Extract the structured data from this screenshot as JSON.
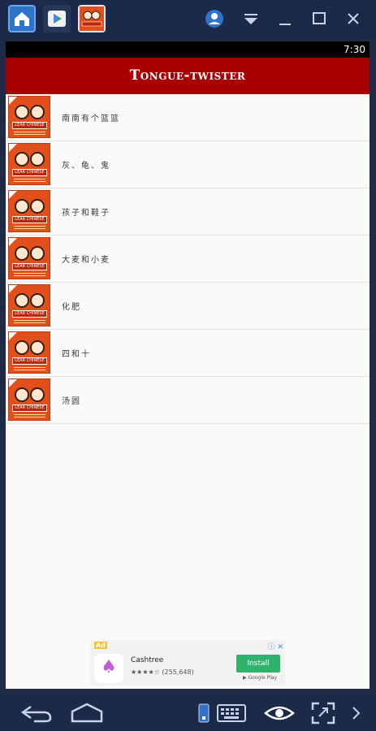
{
  "emulator": {
    "tabs": [
      {
        "name": "home",
        "icon": "home-icon"
      },
      {
        "name": "play-store",
        "icon": "play-store-icon"
      },
      {
        "name": "app",
        "icon": "app-thumbnail-icon"
      }
    ],
    "top_icons": [
      "account-icon",
      "dropdown-icon",
      "minimize-icon",
      "maximize-icon",
      "close-icon"
    ],
    "bottom_icons": [
      "back-icon",
      "home-icon",
      "phone-icon",
      "keyboard-icon",
      "eye-icon",
      "fullscreen-icon",
      "chevron-right-icon"
    ]
  },
  "status_bar": {
    "time": "7:30"
  },
  "app_bar": {
    "title": "Tongue-twister",
    "color": "#a80000"
  },
  "list": {
    "items": [
      {
        "label": "南南有个篮篮",
        "thumb_text": "LEAR CHINESE"
      },
      {
        "label": "灰、龟、鬼",
        "thumb_text": "LEAR CHINESE"
      },
      {
        "label": "孩子和鞋子",
        "thumb_text": "LEAR CHINESE"
      },
      {
        "label": "大麦和小麦",
        "thumb_text": "LEAR CHINESE"
      },
      {
        "label": "化肥",
        "thumb_text": "LEAR CHINESE"
      },
      {
        "label": "四和十",
        "thumb_text": "LEAR CHINESE"
      },
      {
        "label": "汤圆",
        "thumb_text": "LEAR CHINESE"
      }
    ]
  },
  "ad": {
    "tag": "Ad",
    "name": "Cashtree",
    "rating": "★★★★☆ (255,648)",
    "install_label": "Install",
    "store_label": "Google Play"
  }
}
